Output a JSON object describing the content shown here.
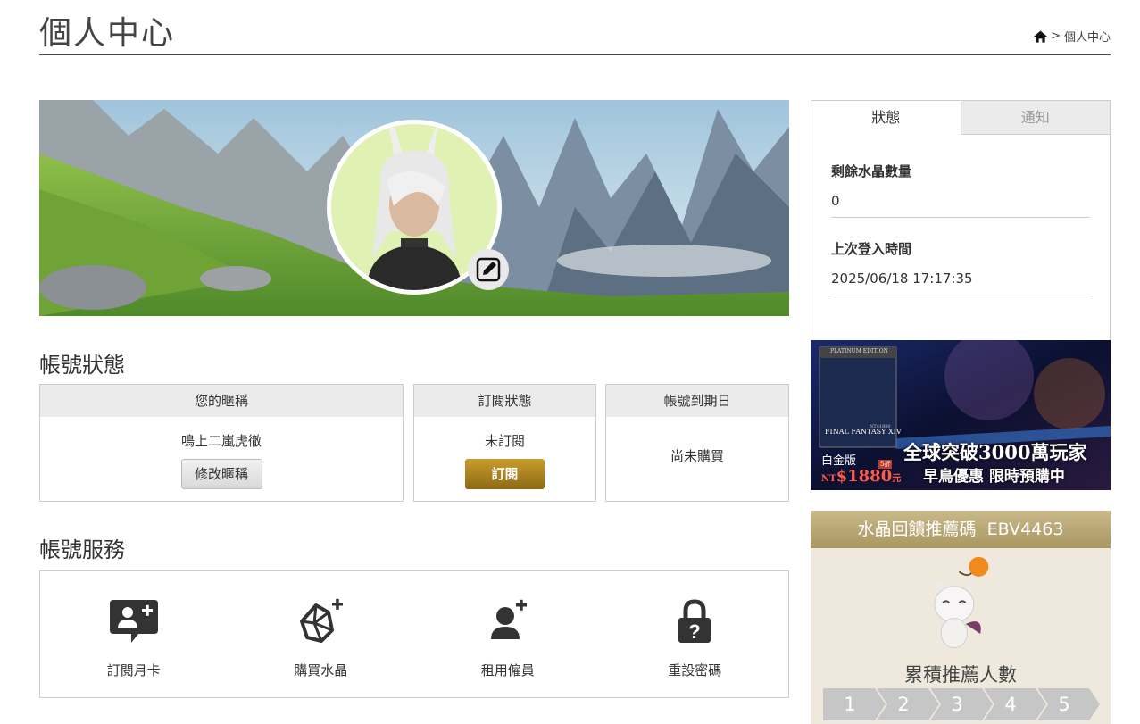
{
  "header": {
    "title": "個人中心",
    "breadcrumb_current": "個人中心",
    "breadcrumb_sep": ">"
  },
  "account_status": {
    "title": "帳號狀態",
    "nickname": {
      "label": "您的暱稱",
      "value": "鳴上二嵐虎徹",
      "button": "修改暱稱"
    },
    "subscription": {
      "label": "訂閱狀態",
      "value": "未訂閱",
      "button": "訂閱"
    },
    "expiry": {
      "label": "帳號到期日",
      "value": "尚未購買"
    }
  },
  "account_services": {
    "title": "帳號服務",
    "items": [
      {
        "label": "訂閱月卡",
        "icon": "add-user-card-icon"
      },
      {
        "label": "購買水晶",
        "icon": "crystal-plus-icon"
      },
      {
        "label": "租用僱員",
        "icon": "user-plus-icon"
      },
      {
        "label": "重設密碼",
        "icon": "lock-question-icon"
      }
    ]
  },
  "side_panel": {
    "tabs": [
      {
        "label": "狀態",
        "active": true
      },
      {
        "label": "通知",
        "active": false
      }
    ],
    "crystal_label": "剩餘水晶數量",
    "crystal_value": "0",
    "last_login_label": "上次登入時間",
    "last_login_value": "2025/06/18 17:17:35"
  },
  "ad": {
    "edition": "PLATINUM EDITION",
    "game": "FINAL FANTASY XIV",
    "code": "NT$1880",
    "edition_cn": "白金版",
    "price_prefix": "NT",
    "price": "$1880",
    "price_suffix": "元",
    "tag": "5折",
    "headline": "全球突破3000萬玩家",
    "subline": "早鳥優惠 限時預購中"
  },
  "referral": {
    "title": "水晶回饋推薦碼",
    "code": "EBV4463",
    "count_label": "累積推薦人數",
    "steps": [
      "1",
      "2",
      "3",
      "4",
      "5"
    ]
  },
  "colors": {
    "gold": "#a8822a",
    "tab_inactive": "#ebebeb",
    "referral_header": "#b6a675"
  }
}
